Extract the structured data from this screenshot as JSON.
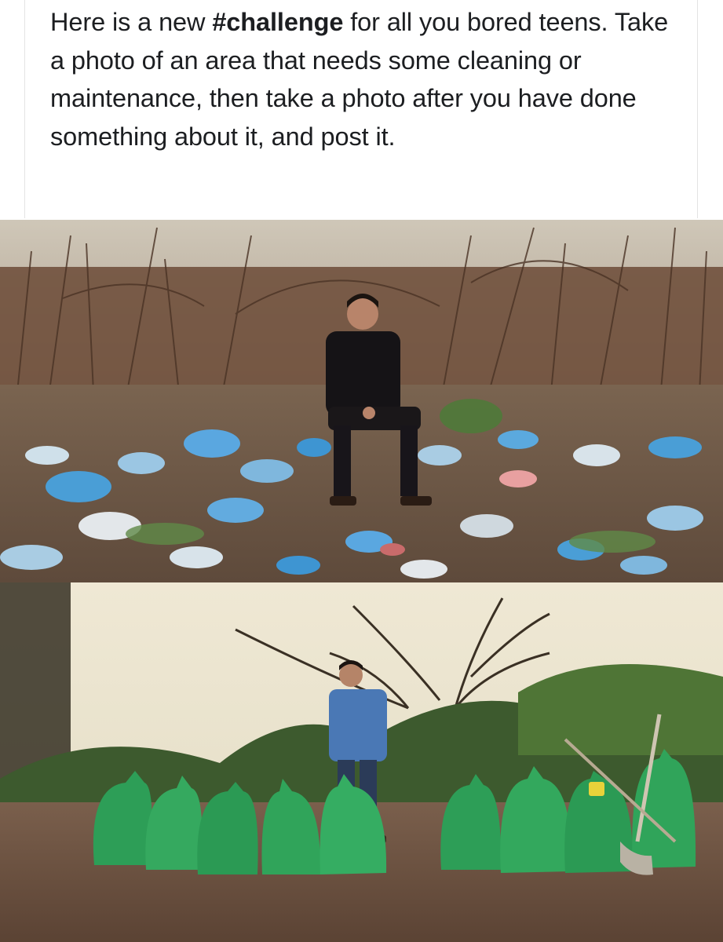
{
  "post": {
    "text_before": "Here is a new ",
    "hashtag": "#challenge",
    "text_after": " for all you bored teens. Take a photo of an area that needs some cleaning or maintenance, then take a photo after you have done something about it, and post it."
  },
  "colors": {
    "text": "#1c1e21",
    "trash_blue": "#4a9ed6",
    "bag_green": "#2d9e57",
    "sky": "#ece6d2",
    "dirt": "#6b5444"
  },
  "photos": [
    {
      "name": "before-photo",
      "bag_count": 0
    },
    {
      "name": "after-photo",
      "bag_count": 9
    }
  ]
}
